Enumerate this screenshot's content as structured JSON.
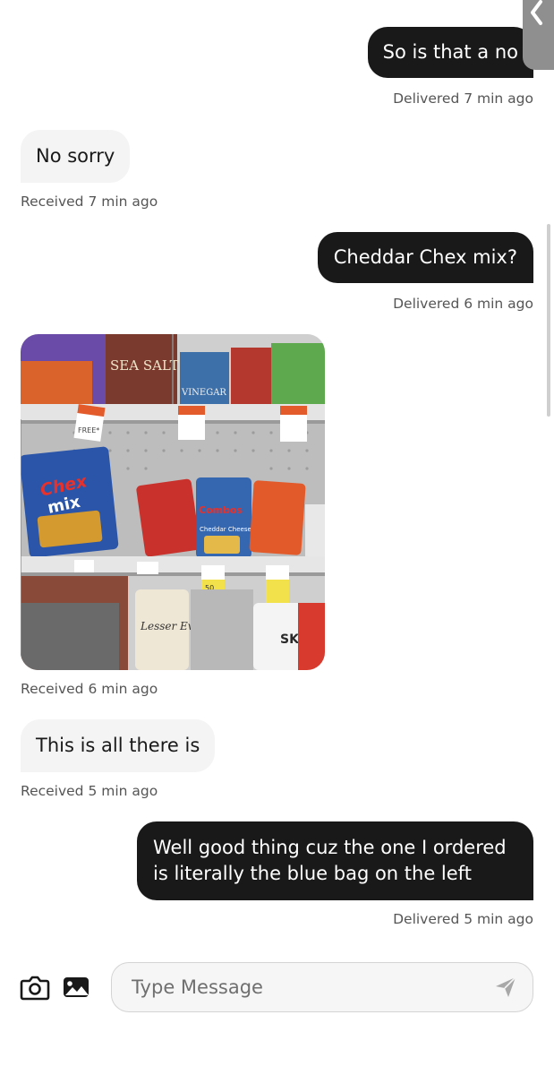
{
  "messages": [
    {
      "direction": "out",
      "text": "So is that a no",
      "status": "Delivered 7 min ago"
    },
    {
      "direction": "in",
      "text": "No sorry",
      "status": "Received 7 min ago"
    },
    {
      "direction": "out",
      "text": "Cheddar Chex mix?",
      "status": "Delivered 6 min ago"
    },
    {
      "direction": "in",
      "kind": "photo",
      "status": "Received 6 min ago"
    },
    {
      "direction": "in",
      "text": "This is all there is",
      "status": "Received 5 min ago"
    },
    {
      "direction": "out",
      "text": "Well good thing cuz the one I ordered is literally the blue bag on the left",
      "status": "Delivered 5 min ago"
    }
  ],
  "photo": {
    "labels": {
      "sea_salt": "SEA SALT",
      "vinegar": "VINEGAR",
      "free": "FREE*",
      "chex": "Chex",
      "mix": "mix",
      "combos": "Combos",
      "cheddar": "Cheddar Cheese",
      "lesser_evil": "Lesser Evil",
      "skinny": "SKINNY",
      "price_50": "50"
    }
  },
  "composer": {
    "placeholder": "Type Message",
    "camera_icon": "camera-icon",
    "gallery_icon": "gallery-icon",
    "send_icon": "send-icon"
  },
  "colors": {
    "outgoing_bubble": "#191919",
    "incoming_bubble": "#f4f4f4",
    "meta_text": "#555555"
  }
}
